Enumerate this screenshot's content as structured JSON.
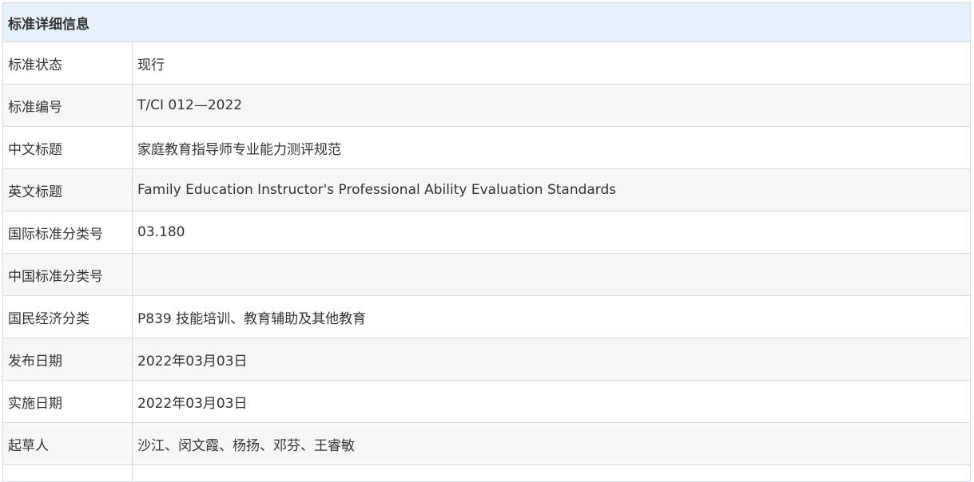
{
  "header": {
    "title": "标准详细信息"
  },
  "rows": [
    {
      "label": "标准状态",
      "value": "现行"
    },
    {
      "label": "标准编号",
      "value": "T/CI 012—2022"
    },
    {
      "label": "中文标题",
      "value": "家庭教育指导师专业能力测评规范"
    },
    {
      "label": "英文标题",
      "value": "Family Education Instructor's Professional Ability Evaluation Standards"
    },
    {
      "label": "国际标准分类号",
      "value": "03.180"
    },
    {
      "label": "中国标准分类号",
      "value": ""
    },
    {
      "label": "国民经济分类",
      "value": "P839 技能培训、教育辅助及其他教育"
    },
    {
      "label": "发布日期",
      "value": "2022年03月03日"
    },
    {
      "label": "实施日期",
      "value": "2022年03月03日"
    },
    {
      "label": "起草人",
      "value": "沙江、闵文霞、杨扬、邓芬、王睿敏"
    }
  ],
  "colors": {
    "header_bg": "#e6f1fc",
    "alt_row_bg": "#f7f7f7",
    "border": "#d4dbe3",
    "text": "#333333"
  }
}
